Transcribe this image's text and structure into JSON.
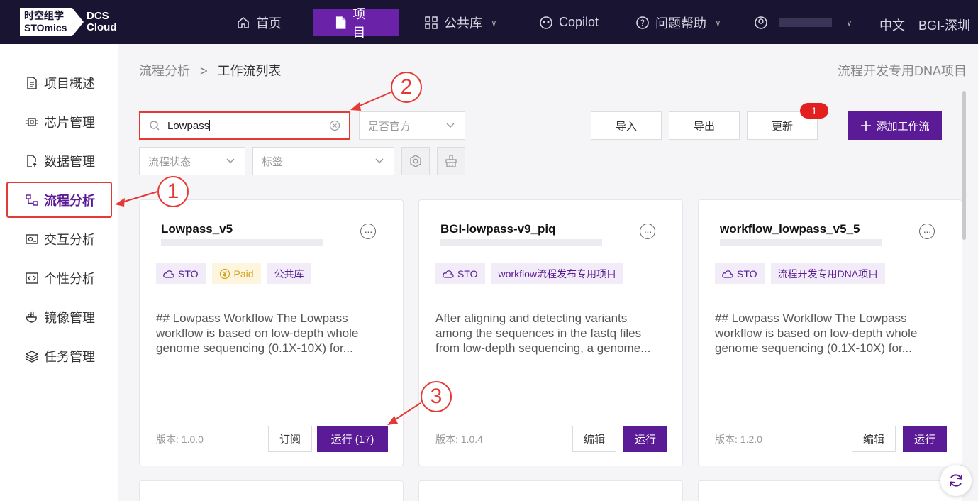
{
  "topbar": {
    "logo_cn": "时空组学",
    "logo_en": "STOmics",
    "logo_dcs": "DCS",
    "logo_cloud": "Cloud",
    "nav": {
      "home": "首页",
      "project": "项目",
      "public": "公共库",
      "copilot": "Copilot",
      "help": "问题帮助"
    },
    "lang": "中文",
    "region": "BGI-深圳"
  },
  "sidebar": {
    "items": [
      {
        "label": "项目概述",
        "icon": "document-icon"
      },
      {
        "label": "芯片管理",
        "icon": "chip-icon"
      },
      {
        "label": "数据管理",
        "icon": "file-upload-icon"
      },
      {
        "label": "流程分析",
        "icon": "workflow-icon"
      },
      {
        "label": "交互分析",
        "icon": "image-analysis-icon"
      },
      {
        "label": "个性分析",
        "icon": "code-icon"
      },
      {
        "label": "镜像管理",
        "icon": "docker-icon"
      },
      {
        "label": "任务管理",
        "icon": "layers-icon"
      }
    ]
  },
  "breadcrumb": {
    "parent": "流程分析",
    "separator": ">",
    "current": "工作流列表"
  },
  "project_name": "流程开发专用DNA项目",
  "filters": {
    "search_value": "Lowpass",
    "official_placeholder": "是否官方",
    "status_placeholder": "流程状态",
    "tag_placeholder": "标签"
  },
  "actions": {
    "import": "导入",
    "export": "导出",
    "update": "更新",
    "update_badge": "1",
    "add": "添加工作流"
  },
  "cards": [
    {
      "title": "Lowpass_v5",
      "tags": [
        "STO",
        "Paid",
        "公共库"
      ],
      "desc": "## Lowpass Workflow The Lowpass workflow is based on low-depth whole genome sequencing (0.1X-10X) for...",
      "version_label": "版本:",
      "version": "1.0.0",
      "btn_secondary": "订阅",
      "btn_primary": "运行 (17)"
    },
    {
      "title": "BGI-lowpass-v9_piq",
      "tags": [
        "STO",
        "workflow流程发布专用项目"
      ],
      "desc": "After aligning and detecting variants among the sequences in the fastq files from low-depth sequencing, a genome...",
      "version_label": "版本:",
      "version": "1.0.4",
      "btn_secondary": "编辑",
      "btn_primary": "运行"
    },
    {
      "title": "workflow_lowpass_v5_5",
      "tags": [
        "STO",
        "流程开发专用DNA项目"
      ],
      "desc": "## Lowpass Workflow The Lowpass workflow is based on low-depth whole genome sequencing (0.1X-10X) for...",
      "version_label": "版本:",
      "version": "1.2.0",
      "btn_secondary": "编辑",
      "btn_primary": "运行"
    }
  ],
  "annotations": [
    "1",
    "2",
    "3"
  ],
  "colors": {
    "brand": "#5b1a96",
    "topbar": "#1a1433",
    "highlight": "#e53935"
  }
}
